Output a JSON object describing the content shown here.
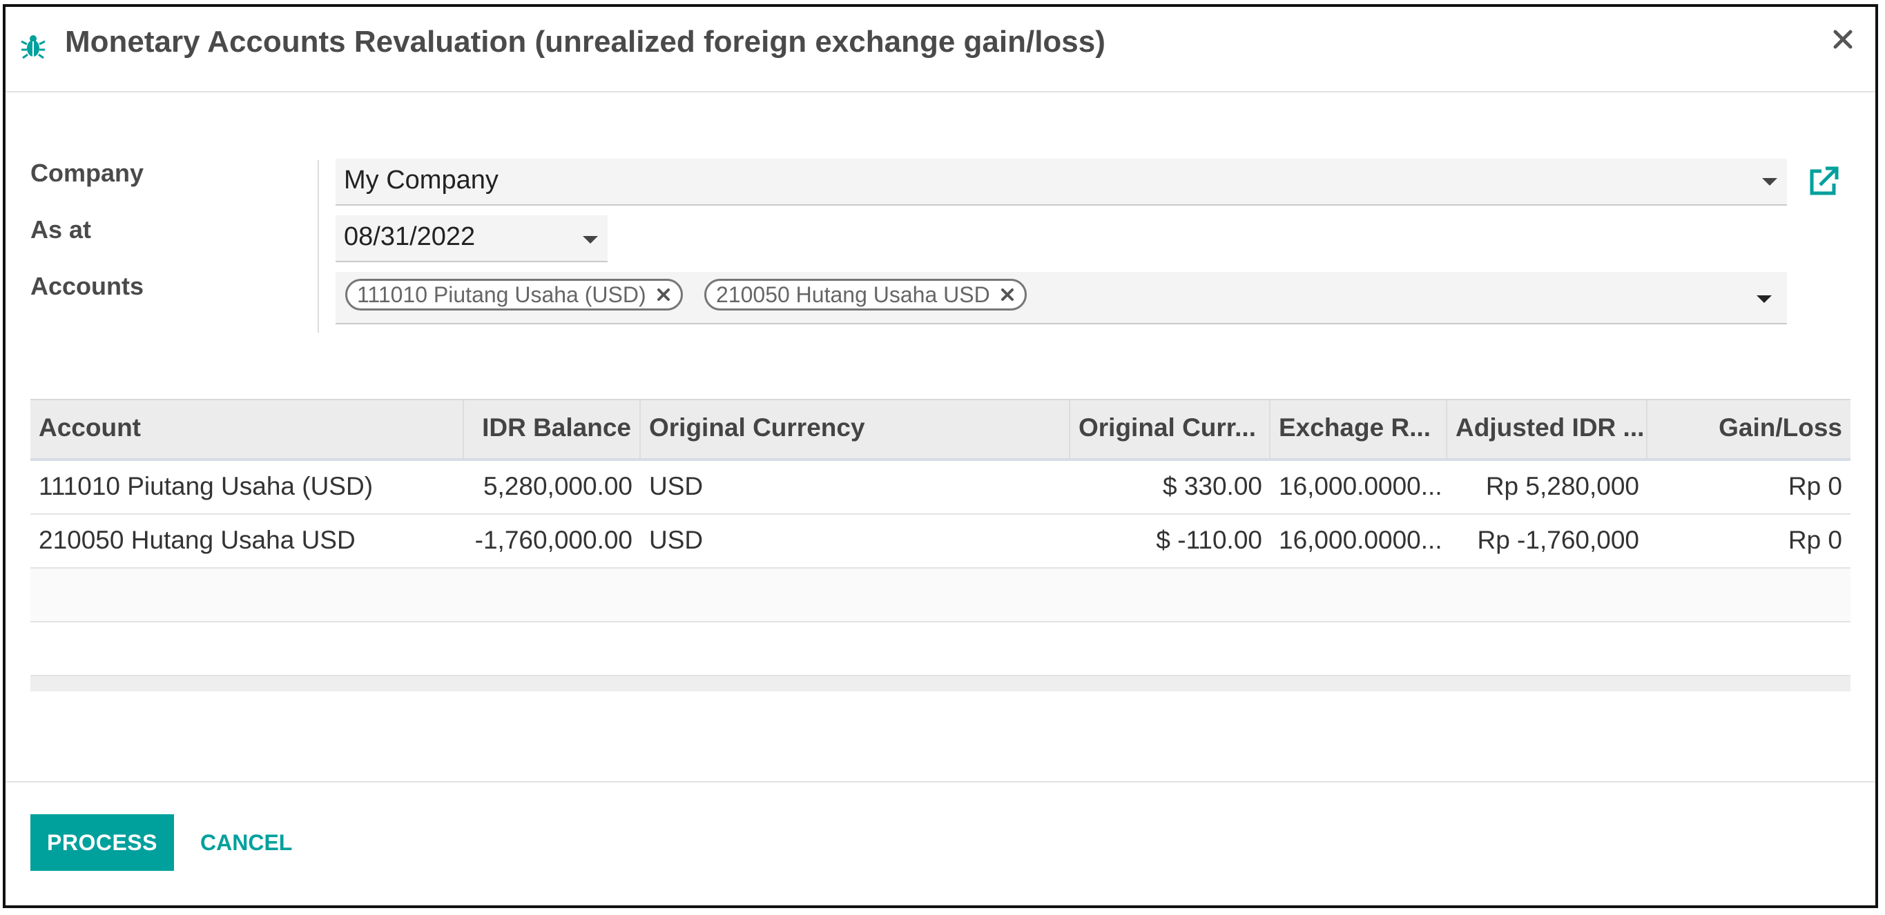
{
  "dialog": {
    "title": "Monetary Accounts Revaluation (unrealized foreign exchange gain/loss)",
    "accent_color": "#00a09d",
    "icons": {
      "title_icon": "bug-icon",
      "close": "close-icon",
      "external_link": "external-link-icon",
      "dropdown": "chevron-down-icon",
      "tag_remove": "remove-tag-icon"
    }
  },
  "form": {
    "company": {
      "label": "Company",
      "value": "My Company"
    },
    "as_at": {
      "label": "As at",
      "value": "08/31/2022"
    },
    "accounts": {
      "label": "Accounts",
      "tags": [
        "111010 Piutang Usaha (USD)",
        "210050 Hutang Usaha USD"
      ]
    }
  },
  "table": {
    "headers": [
      "Account",
      "IDR Balance",
      "Original Currency",
      "Original Curr...",
      "Exchage R...",
      "Adjusted IDR ...",
      "Gain/Loss"
    ],
    "rows": [
      [
        "111010 Piutang Usaha (USD)",
        "5,280,000.00",
        "USD",
        "$ 330.00",
        "16,000.0000...",
        "Rp 5,280,000",
        "Rp 0"
      ],
      [
        "210050 Hutang Usaha USD",
        "-1,760,000.00",
        "USD",
        "$ -110.00",
        "16,000.0000...",
        "Rp -1,760,000",
        "Rp 0"
      ]
    ]
  },
  "footer": {
    "process_label": "PROCESS",
    "cancel_label": "CANCEL"
  }
}
